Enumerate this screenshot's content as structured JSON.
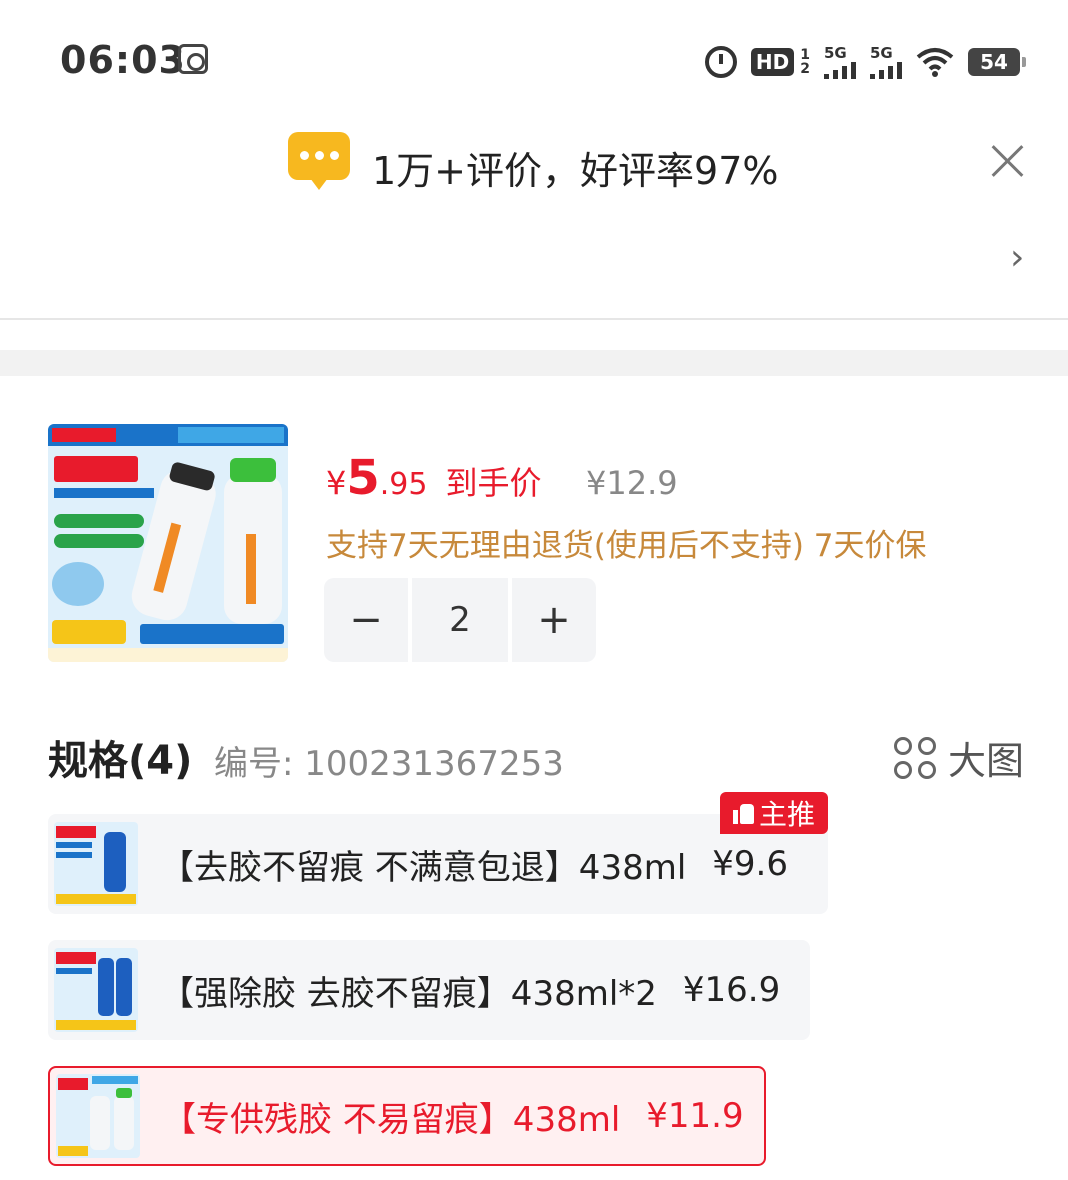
{
  "status_bar": {
    "time": "06:03",
    "hd_label": "HD",
    "hd_sub_top": "1",
    "hd_sub_bottom": "2",
    "signal1_label": "5G",
    "signal2_label": "5G",
    "battery": "54"
  },
  "toast": {
    "text": "1万+评价，好评率97%"
  },
  "product": {
    "price_yen": "¥",
    "price_int": "5",
    "price_dec": ".95",
    "price_label": "到手价",
    "original_price": "¥12.9",
    "service": "支持7天无理由退货(使用后不支持) 7天价保",
    "quantity": "2",
    "minus": "−",
    "plus": "+"
  },
  "spec": {
    "title": "规格(4)",
    "code": "编号: 100231367253",
    "big_image_label": "大图",
    "badge_label": "主推",
    "options": [
      {
        "label": "【去胶不留痕 不满意包退】438ml",
        "price": "¥9.6"
      },
      {
        "label": "【强除胶 去胶不留痕】438ml*2",
        "price": "¥16.9"
      },
      {
        "label": "【专供残胶 不易留痕】438ml",
        "price": "¥11.9"
      }
    ]
  },
  "colors": {
    "accent_red": "#e81b2c",
    "service_gold": "#c7893b",
    "bubble_yellow": "#f7b81f"
  }
}
